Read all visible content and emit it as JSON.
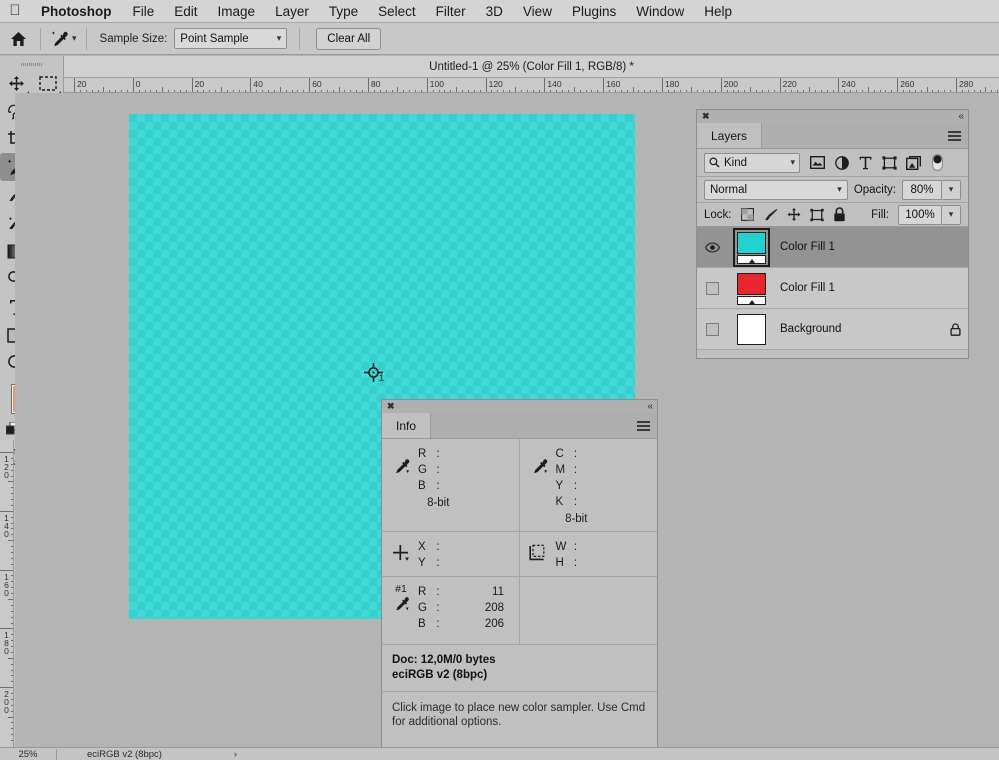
{
  "menubar": {
    "apple_icon": "apple-logo",
    "app_name": "Photoshop",
    "items": [
      "File",
      "Edit",
      "Image",
      "Layer",
      "Type",
      "Select",
      "Filter",
      "3D",
      "View",
      "Plugins",
      "Window",
      "Help"
    ]
  },
  "options_bar": {
    "home_icon": "home-icon",
    "tool_icon": "eyedropper-icon",
    "tool_chevron": "chevron-down-icon",
    "sample_size_label": "Sample Size:",
    "sample_size_value": "Point Sample",
    "clear_all_label": "Clear All"
  },
  "toolbar": {
    "tools": [
      {
        "name": "move-tool",
        "glyph": "move"
      },
      {
        "name": "rectangular-marquee-tool",
        "glyph": "marquee"
      },
      {
        "name": "lasso-tool",
        "glyph": "lasso"
      },
      {
        "name": "magic-wand-tool",
        "glyph": "wand"
      },
      {
        "name": "crop-tool",
        "glyph": "crop"
      },
      {
        "name": "frame-tool",
        "glyph": "frame"
      },
      {
        "name": "eyedropper-tool",
        "glyph": "eyedropper",
        "selected": true
      },
      {
        "name": "healing-brush-tool",
        "glyph": "heal"
      },
      {
        "name": "brush-tool",
        "glyph": "brush"
      },
      {
        "name": "clone-stamp-tool",
        "glyph": "stamp"
      },
      {
        "name": "history-brush-tool",
        "glyph": "historybrush"
      },
      {
        "name": "eraser-tool",
        "glyph": "eraser"
      },
      {
        "name": "gradient-tool",
        "glyph": "gradient"
      },
      {
        "name": "blur-tool",
        "glyph": "blur"
      },
      {
        "name": "dodge-tool",
        "glyph": "dodge"
      },
      {
        "name": "pen-tool",
        "glyph": "pen"
      },
      {
        "name": "type-tool",
        "glyph": "type"
      },
      {
        "name": "path-selection-tool",
        "glyph": "arrow"
      },
      {
        "name": "rectangle-tool",
        "glyph": "rect"
      },
      {
        "name": "hand-tool",
        "glyph": "hand"
      },
      {
        "name": "zoom-tool",
        "glyph": "zoom"
      },
      {
        "name": "edit-toolbar-button",
        "glyph": "dots"
      }
    ],
    "foreground_color": "#e09a6c",
    "background_color": "#5a6f8c",
    "swap_icon": "swap-colors-icon",
    "default_colors_icon": "default-colors-icon",
    "quick_mask_icon": "quick-mask-icon",
    "screen_mode_icon": "screen-mode-icon"
  },
  "document": {
    "title": "Untitled-1 @ 25% (Color Fill 1, RGB/8) *",
    "fill_color": "#11d0ce",
    "ruler_h_labels": [
      "20",
      "0",
      "20",
      "40",
      "60",
      "80",
      "100",
      "120",
      "140",
      "160",
      "180",
      "200",
      "220",
      "240",
      "260",
      "280"
    ],
    "ruler_v_labels": [
      "120",
      "140",
      "160",
      "180",
      "200"
    ],
    "sampler_number": "1"
  },
  "layers_panel": {
    "close_icon": "close-icon",
    "collapse_icon": "collapse-panel-icon",
    "tab_label": "Layers",
    "menu_icon": "panel-menu-icon",
    "filter": {
      "search_icon": "search-icon",
      "kind_label": "Kind",
      "chevron": "chevron-down-icon",
      "icons": [
        "pixel-filter-icon",
        "adjustment-filter-icon",
        "type-filter-icon",
        "shape-filter-icon",
        "smart-object-filter-icon",
        "filter-toggle-icon"
      ]
    },
    "blend_mode": "Normal",
    "opacity_label": "Opacity:",
    "opacity_value": "80%",
    "lock_label": "Lock:",
    "lock_icons": [
      "lock-transparent-pixels-icon",
      "lock-image-pixels-icon",
      "lock-position-icon",
      "lock-artboard-icon",
      "lock-all-icon"
    ],
    "fill_label": "Fill:",
    "fill_value": "100%",
    "layers": [
      {
        "name": "Color Fill 1",
        "visible": true,
        "selected": true,
        "color": "#22d2d0",
        "has_mask": true,
        "locked": false
      },
      {
        "name": "Color Fill 1",
        "visible": false,
        "selected": false,
        "color": "#e8262e",
        "has_mask": true,
        "locked": false
      },
      {
        "name": "Background",
        "visible": false,
        "selected": false,
        "color": "#ffffff",
        "has_mask": false,
        "locked": true
      }
    ]
  },
  "info_panel": {
    "close_icon": "close-icon",
    "collapse_icon": "collapse-panel-icon",
    "tab_label": "Info",
    "menu_icon": "panel-menu-icon",
    "rgb_readout": {
      "icon": "eyedropper-icon",
      "labels": [
        "R",
        "G",
        "B"
      ],
      "values": [
        "",
        "",
        ""
      ],
      "bit_depth": "8-bit"
    },
    "cmyk_readout": {
      "icon": "eyedropper-icon",
      "labels": [
        "C",
        "M",
        "Y",
        "K"
      ],
      "values": [
        "",
        "",
        "",
        ""
      ],
      "bit_depth": "8-bit"
    },
    "position_readout": {
      "icon": "crosshair-icon",
      "labels": [
        "X",
        "Y"
      ],
      "values": [
        "",
        ""
      ]
    },
    "size_readout": {
      "icon": "marquee-size-icon",
      "labels": [
        "W",
        "H"
      ],
      "values": [
        "",
        ""
      ]
    },
    "sampler_readout": {
      "tag": "#1",
      "icon": "eyedropper-icon",
      "labels": [
        "R",
        "G",
        "B"
      ],
      "values": [
        "11",
        "208",
        "206"
      ]
    },
    "doc_line1": "Doc: 12,0M/0 bytes",
    "doc_line2": "eciRGB v2 (8bpc)",
    "hint": "Click image to place new color sampler.  Use Cmd for additional options."
  },
  "statusbar": {
    "zoom": "25%",
    "profile": "eciRGB v2 (8bpc)",
    "arrow_icon": "chevron-right-icon"
  }
}
